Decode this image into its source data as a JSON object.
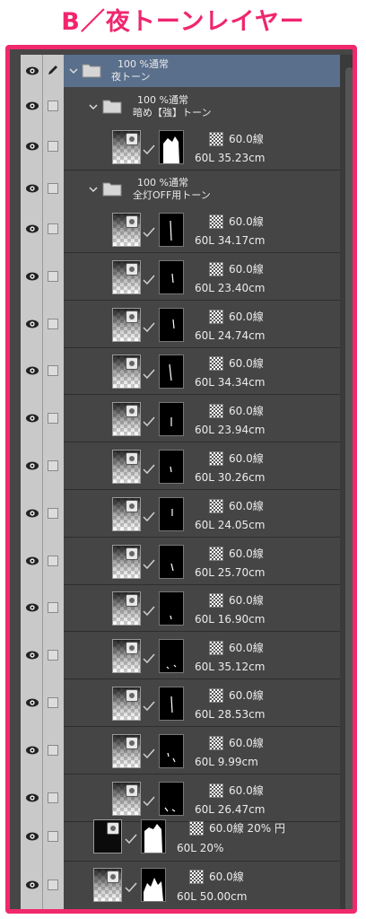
{
  "heading": "B／夜トーンレイヤー",
  "colors": {
    "accent": "#f2286c",
    "panel": "#454545",
    "selected_row": "#5a6f8c"
  },
  "folders": [
    {
      "line1": "100 %通常",
      "line2": "夜トーン"
    },
    {
      "line1": "100 %通常",
      "line2": "暗め【強】トーン"
    },
    {
      "line1": "100 %通常",
      "line2": "全灯OFF用トーン"
    }
  ],
  "layers": [
    {
      "line": "60.0線",
      "size": "60L 35.23cm"
    },
    {
      "line": "60.0線",
      "size": "60L 34.17cm"
    },
    {
      "line": "60.0線",
      "size": "60L 23.40cm"
    },
    {
      "line": "60.0線",
      "size": "60L 24.74cm"
    },
    {
      "line": "60.0線",
      "size": "60L 34.34cm"
    },
    {
      "line": "60.0線",
      "size": "60L 23.94cm"
    },
    {
      "line": "60.0線",
      "size": "60L 30.26cm"
    },
    {
      "line": "60.0線",
      "size": "60L 24.05cm"
    },
    {
      "line": "60.0線",
      "size": "60L 25.70cm"
    },
    {
      "line": "60.0線",
      "size": "60L 16.90cm"
    },
    {
      "line": "60.0線",
      "size": "60L 35.12cm"
    },
    {
      "line": "60.0線",
      "size": "60L 28.53cm"
    },
    {
      "line": "60.0線",
      "size": "60L 9.99cm"
    },
    {
      "line": "60.0線",
      "size": "60L 26.47cm"
    },
    {
      "line": "60.0線 20% 円",
      "size": "60L 20%"
    },
    {
      "line": "60.0線",
      "size": "60L 50.00cm"
    }
  ],
  "icons": {
    "visibility": "eye-icon",
    "folder": "folder-icon",
    "expand": "chevron-down-icon",
    "edit": "pen-icon",
    "tone": "tone-pattern-icon",
    "mask_link": "checkmark-icon"
  }
}
